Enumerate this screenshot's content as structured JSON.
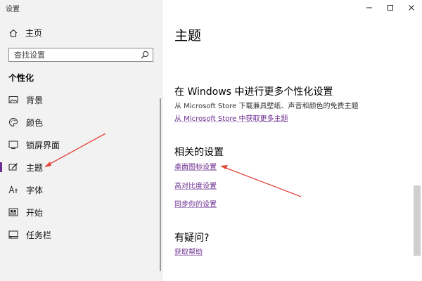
{
  "window": {
    "title": "设置",
    "controls": {
      "minimize_icon": "minimize-icon",
      "maximize_icon": "maximize-icon",
      "close_icon": "close-icon"
    }
  },
  "sidebar": {
    "home_label": "主页",
    "search_placeholder": "查找设置",
    "section_title": "个性化",
    "items": [
      {
        "label": "背景",
        "icon": "picture-icon",
        "active": false
      },
      {
        "label": "颜色",
        "icon": "palette-icon",
        "active": false
      },
      {
        "label": "锁屏界面",
        "icon": "lock-screen-icon",
        "active": false
      },
      {
        "label": "主题",
        "icon": "theme-icon",
        "active": true
      },
      {
        "label": "字体",
        "icon": "font-icon",
        "active": false
      },
      {
        "label": "开始",
        "icon": "start-icon",
        "active": false
      },
      {
        "label": "任务栏",
        "icon": "taskbar-icon",
        "active": false
      }
    ]
  },
  "main": {
    "title": "主题",
    "store_section": {
      "heading": "在 Windows 中进行更多个性化设置",
      "description": "从 Microsoft Store 下载兼具壁纸、声音和颜色的免费主题",
      "link": "从 Microsoft Store 中获取更多主题"
    },
    "related_section": {
      "heading": "相关的设置",
      "links": [
        "桌面图标设置",
        "高对比度设置",
        "同步你的设置"
      ]
    },
    "help_section": {
      "heading": "有疑问?",
      "link": "获取帮助"
    }
  },
  "colors": {
    "accent": "#6b2c8f",
    "annotation_arrow": "#e2463a",
    "sidebar_bg": "#f2f2f2"
  }
}
